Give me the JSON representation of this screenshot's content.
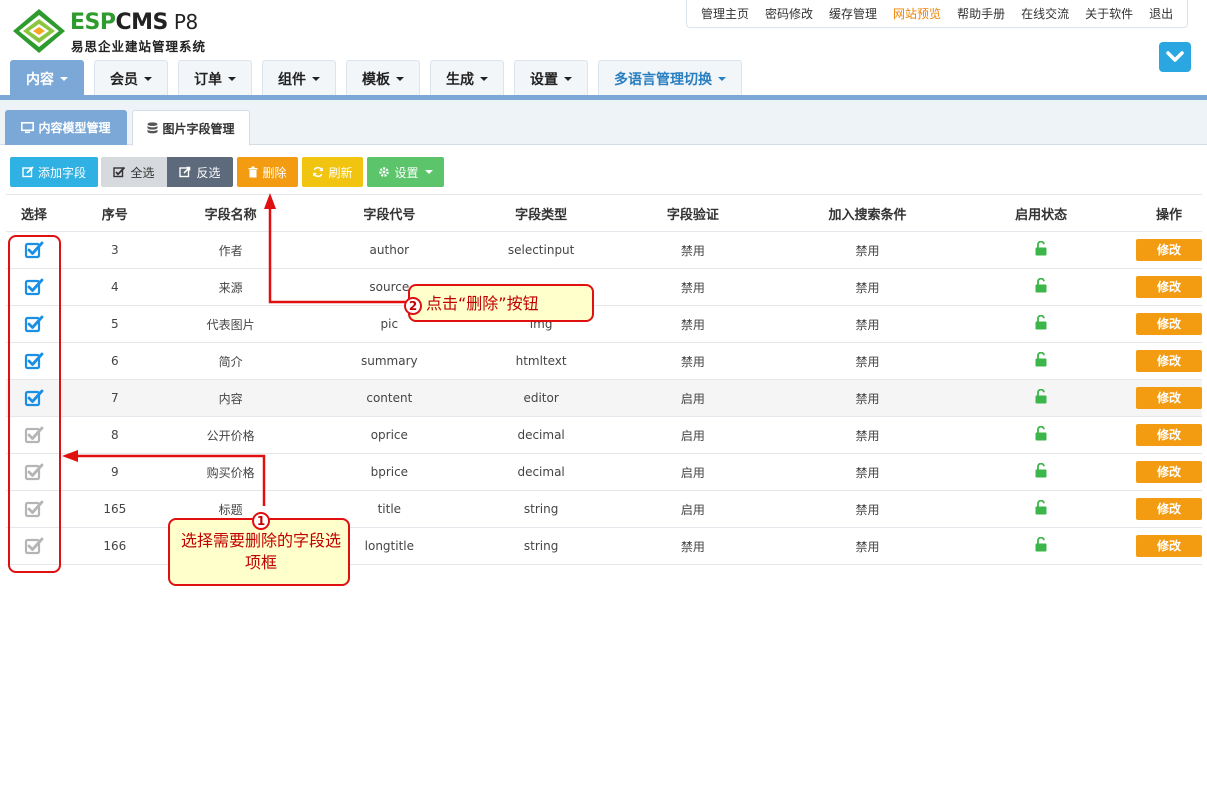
{
  "brand": {
    "esp": "ESP",
    "cms": "CMS",
    "version": "P8",
    "subtitle": "易思企业建站管理系统"
  },
  "top_links": [
    {
      "label": "管理主页",
      "active": false
    },
    {
      "label": "密码修改",
      "active": false
    },
    {
      "label": "缓存管理",
      "active": false
    },
    {
      "label": "网站预览",
      "active": true
    },
    {
      "label": "帮助手册",
      "active": false
    },
    {
      "label": "在线交流",
      "active": false
    },
    {
      "label": "关于软件",
      "active": false
    },
    {
      "label": "退出",
      "active": false
    }
  ],
  "main_tabs": [
    {
      "label": "内容",
      "active": true
    },
    {
      "label": "会员"
    },
    {
      "label": "订单"
    },
    {
      "label": "组件"
    },
    {
      "label": "模板"
    },
    {
      "label": "生成"
    },
    {
      "label": "设置"
    },
    {
      "label": "多语言管理切换"
    }
  ],
  "sub_tabs": {
    "model": "内容模型管理",
    "image": "图片字段管理"
  },
  "toolbar": {
    "add": "添加字段",
    "select_all": "全选",
    "invert": "反选",
    "delete": "删除",
    "refresh": "刷新",
    "settings": "设置"
  },
  "table": {
    "headers": [
      "选择",
      "序号",
      "字段名称",
      "字段代号",
      "字段类型",
      "字段验证",
      "加入搜索条件",
      "启用状态",
      "操作"
    ],
    "rows": [
      {
        "checked": true,
        "id": "3",
        "name": "作者",
        "code": "author",
        "type": "selectinput",
        "validate": "禁用",
        "search": "禁用",
        "edit": "修改"
      },
      {
        "checked": true,
        "id": "4",
        "name": "来源",
        "code": "source",
        "type": "",
        "validate": "禁用",
        "search": "禁用",
        "edit": "修改"
      },
      {
        "checked": true,
        "id": "5",
        "name": "代表图片",
        "code": "pic",
        "type": "img",
        "validate": "禁用",
        "search": "禁用",
        "edit": "修改"
      },
      {
        "checked": true,
        "id": "6",
        "name": "简介",
        "code": "summary",
        "type": "htmltext",
        "validate": "禁用",
        "search": "禁用",
        "edit": "修改"
      },
      {
        "checked": true,
        "id": "7",
        "name": "内容",
        "code": "content",
        "type": "editor",
        "validate": "启用",
        "search": "禁用",
        "edit": "修改",
        "highlight": true
      },
      {
        "checked": false,
        "id": "8",
        "name": "公开价格",
        "code": "oprice",
        "type": "decimal",
        "validate": "启用",
        "search": "禁用",
        "edit": "修改"
      },
      {
        "checked": false,
        "id": "9",
        "name": "购买价格",
        "code": "bprice",
        "type": "decimal",
        "validate": "启用",
        "search": "禁用",
        "edit": "修改"
      },
      {
        "checked": false,
        "id": "165",
        "name": "标题",
        "code": "title",
        "type": "string",
        "validate": "启用",
        "search": "禁用",
        "edit": "修改"
      },
      {
        "checked": false,
        "id": "166",
        "name": "",
        "code": "longtitle",
        "type": "string",
        "validate": "禁用",
        "search": "禁用",
        "edit": "修改"
      }
    ]
  },
  "annotations": {
    "step1_num": "1",
    "step1_text": "选择需要删除的字段选项框",
    "step2_num": "2",
    "step2_text": "点击“删除”按钮"
  },
  "colors": {
    "accent_blue": "#7ba8d6",
    "checkbox_blue": "#1a8fe3",
    "disabled_red": "#e74c3c",
    "enabled_green": "#3cb54a",
    "edit_orange": "#f39c12",
    "annotation_red": "#e01010",
    "annotation_bg": "#ffffcc"
  }
}
